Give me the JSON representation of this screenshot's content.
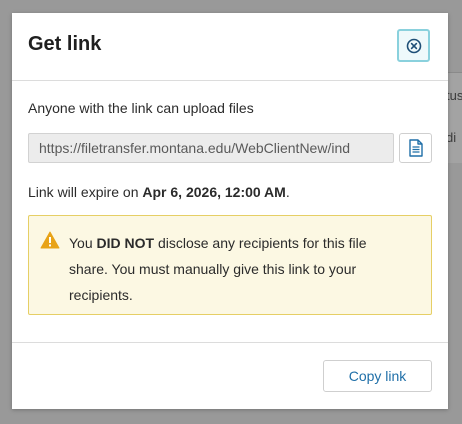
{
  "background": {
    "row1_text": "tus",
    "row2_text": "di"
  },
  "dialog": {
    "title": "Get link",
    "close_icon": "close-circle-icon",
    "permission_text": "Anyone with the link can upload files",
    "link_url": "https://filetransfer.montana.edu/WebClientNew/ind",
    "copy_icon": "document-copy-icon",
    "expire_prefix": "Link will expire on ",
    "expire_date": "Apr 6, 2026, 12:00 AM",
    "expire_suffix": ".",
    "warning": {
      "icon": "warning-triangle-icon",
      "prefix": "You ",
      "emphasis": "DID NOT",
      "rest": " disclose any recipients for this file share. You must manually give this link to your recipients."
    },
    "copy_link_label": "Copy link"
  },
  "colors": {
    "accent": "#1f6fa8",
    "close_border": "#8ad1dd",
    "warning_bg": "#fcf8e3",
    "warning_border": "#e6cf65",
    "warning_icon": "#e8a317"
  }
}
